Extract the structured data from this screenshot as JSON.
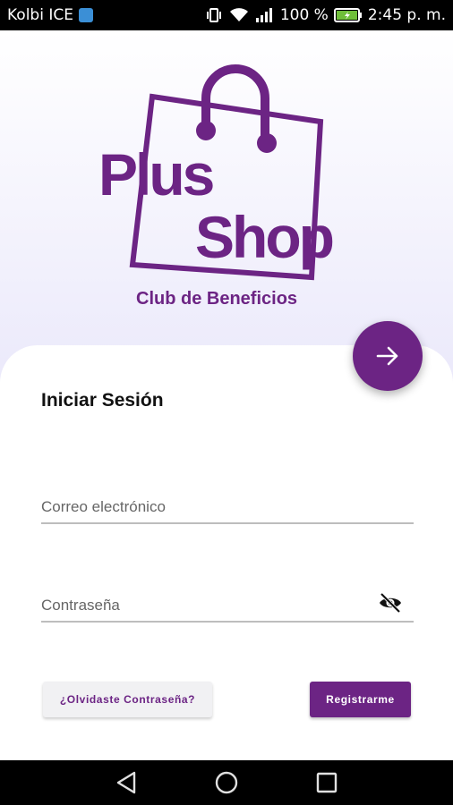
{
  "status_bar": {
    "carrier": "Kolbi ICE",
    "battery": "100 %",
    "time": "2:45 p. m."
  },
  "logo": {
    "line1": "Plus",
    "line2": "Shop",
    "tagline": "Club de Beneficios",
    "color": "#6c2484"
  },
  "login": {
    "title": "Iniciar Sesión",
    "email_placeholder": "Correo electrónico",
    "password_placeholder": "Contraseña",
    "forgot_label": "¿Olvidaste Contraseña?",
    "register_label": "Registrarme"
  },
  "icons": {
    "fab": "arrow-right-icon",
    "password_toggle": "eye-off-icon",
    "nav": [
      "back-icon",
      "home-icon",
      "recents-icon"
    ]
  }
}
